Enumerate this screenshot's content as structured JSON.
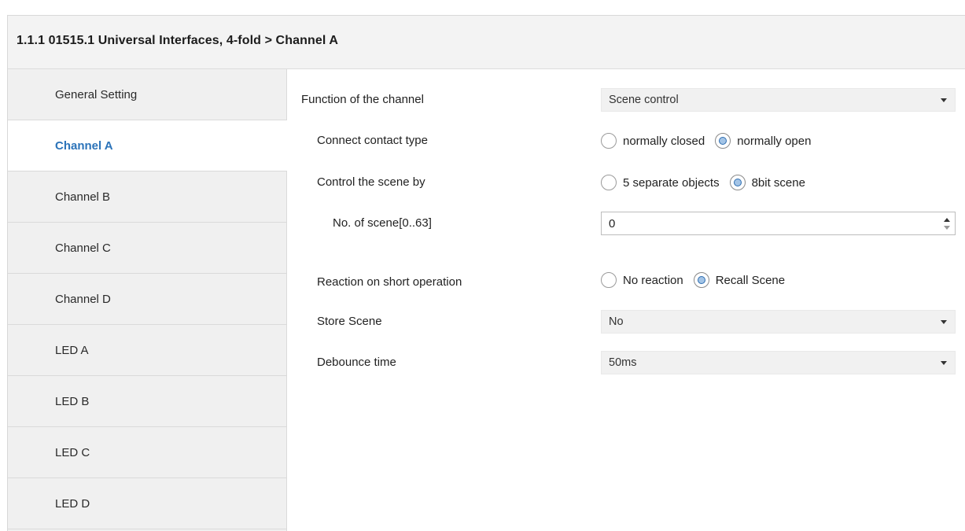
{
  "header": {
    "title": "1.1.1 01515.1 Universal Interfaces, 4-fold > Channel A"
  },
  "sidebar": {
    "items": [
      {
        "label": "General Setting",
        "active": false
      },
      {
        "label": "Channel A",
        "active": true
      },
      {
        "label": "Channel B",
        "active": false
      },
      {
        "label": "Channel C",
        "active": false
      },
      {
        "label": "Channel D",
        "active": false
      },
      {
        "label": "LED A",
        "active": false
      },
      {
        "label": "LED B",
        "active": false
      },
      {
        "label": "LED C",
        "active": false
      },
      {
        "label": "LED D",
        "active": false
      }
    ]
  },
  "params": {
    "function": {
      "label": "Function of the channel",
      "value": "Scene control"
    },
    "contact_type": {
      "label": "Connect contact type",
      "options": [
        "normally closed",
        "normally open"
      ],
      "selected": "normally open"
    },
    "control_by": {
      "label": "Control the scene by",
      "options": [
        "5 separate objects",
        "8bit scene"
      ],
      "selected": "8bit scene"
    },
    "scene_no": {
      "label": "No. of scene[0..63]",
      "value": "0"
    },
    "short_reaction": {
      "label": "Reaction on short operation",
      "options": [
        "No reaction",
        "Recall Scene"
      ],
      "selected": "Recall Scene"
    },
    "store_scene": {
      "label": "Store Scene",
      "value": "No"
    },
    "debounce": {
      "label": "Debounce time",
      "value": "50ms"
    }
  },
  "colors": {
    "active_text": "#2b73b9",
    "radio_fill": "#a3c4e6",
    "sidebar_bg": "#f0f0f0",
    "title_bar_bg": "#f3f3f3"
  }
}
